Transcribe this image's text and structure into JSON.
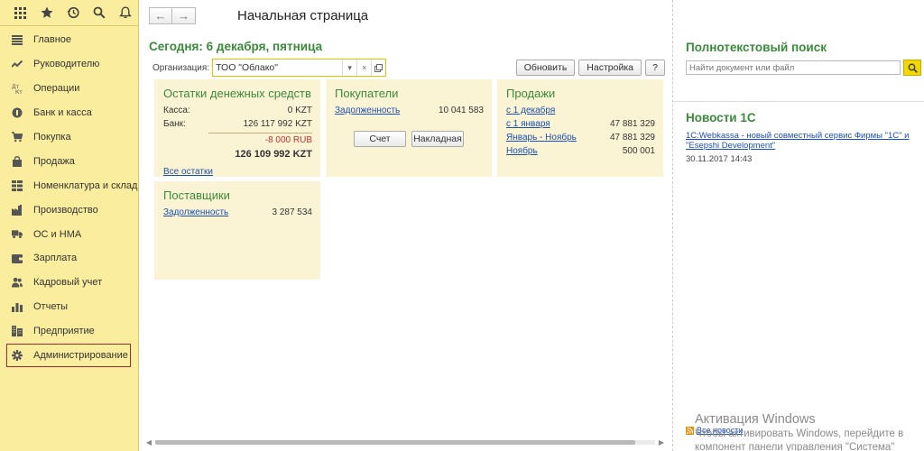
{
  "sidebar": {
    "top_icons": [
      "apps-grid-icon",
      "star-icon",
      "history-icon",
      "search-icon",
      "bell-icon"
    ],
    "items": [
      {
        "label": "Главное",
        "icon": "menu-lines-icon"
      },
      {
        "label": "Руководителю",
        "icon": "trend-chart-icon"
      },
      {
        "label": "Операции",
        "icon": "dt-kt-icon"
      },
      {
        "label": "Банк и касса",
        "icon": "coin-icon"
      },
      {
        "label": "Покупка",
        "icon": "cart-icon"
      },
      {
        "label": "Продажа",
        "icon": "bag-icon"
      },
      {
        "label": "Номенклатура и склад",
        "icon": "grid-blocks-icon"
      },
      {
        "label": "Производство",
        "icon": "factory-icon"
      },
      {
        "label": "ОС и НМА",
        "icon": "truck-icon"
      },
      {
        "label": "Зарплата",
        "icon": "wallet-icon"
      },
      {
        "label": "Кадровый учет",
        "icon": "users-icon"
      },
      {
        "label": "Отчеты",
        "icon": "bar-chart-icon"
      },
      {
        "label": "Предприятие",
        "icon": "building-icon"
      },
      {
        "label": "Администрирование",
        "icon": "gear-icon"
      }
    ],
    "selected_index": 13
  },
  "header": {
    "title": "Начальная страница"
  },
  "main": {
    "today": "Сегодня: 6 декабря, пятница",
    "org_label": "Организация:",
    "org_value": "ТОО \"Облако\"",
    "refresh_label": "Обновить",
    "settings_label": "Настройка",
    "help_label": "?",
    "cash": {
      "title": "Остатки денежных средств",
      "kassa_label": "Касса:",
      "kassa_value": "0 KZT",
      "bank_label": "Банк:",
      "bank_value_kzt": "126 117 992 KZT",
      "bank_value_rub": "-8 000 RUB",
      "total": "126 109 992 KZT",
      "all_link": "Все остатки"
    },
    "buyers": {
      "title": "Покупатели",
      "debt_label": "Задолженность",
      "debt_value": "10 041 583",
      "invoice_button": "Счет",
      "waybill_button": "Накладная"
    },
    "sales": {
      "title": "Продажи",
      "rows": [
        {
          "label": "с 1 декабря",
          "value": ""
        },
        {
          "label": "с 1 января",
          "value": "47 881 329"
        },
        {
          "label": "Январь - Ноябрь",
          "value": "47 881 329"
        },
        {
          "label": "Ноябрь",
          "value": "500 001"
        }
      ]
    },
    "suppliers": {
      "title": "Поставщики",
      "debt_label": "Задолженность",
      "debt_value": "3 287 534"
    }
  },
  "right": {
    "search_title": "Полнотекстовый поиск",
    "search_placeholder": "Найти документ или файл",
    "news_title": "Новости 1С",
    "news_link": "1C:Webkassa - новый совместный сервис Фирмы \"1С\" и \"Esepshi Development\"",
    "news_date": "30.11.2017 14:43",
    "all_news": "Все новости",
    "watermark_line1": "Активация Windows",
    "watermark_line2": "Чтобы активировать Windows, перейдите в",
    "watermark_line3": "компонент панели управления \"Система\""
  },
  "colors": {
    "sidebar_bg": "#fbed9e",
    "accent_green": "#3a8a3a",
    "card_bg": "#fbf4d4",
    "link_blue": "#1a4fb5",
    "search_button": "#f2d700"
  }
}
